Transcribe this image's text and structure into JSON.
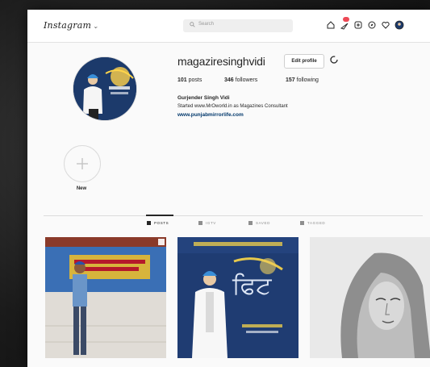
{
  "topbar": {
    "logo": "Instagram",
    "search_placeholder": "Search"
  },
  "profile": {
    "username": "magaziresinghvidi",
    "edit_button": "Edit profile",
    "stats": {
      "posts_count": "101",
      "posts_label": "posts",
      "followers_count": "346",
      "followers_label": "followers",
      "following_count": "157",
      "following_label": "following"
    },
    "bio": {
      "name": "Gurjender Singh Vidi",
      "line": "Started www.MrOworld.in as Magazines Consultant",
      "link": "www.punjabmirrorlife.com"
    }
  },
  "highlights": {
    "new_label": "New"
  },
  "tabs": [
    {
      "label": "POSTS"
    },
    {
      "label": "IGTV"
    },
    {
      "label": "SAVED"
    },
    {
      "label": "TAGGED"
    }
  ],
  "posts": [
    {
      "caption": "Event on stage"
    },
    {
      "caption": "Portrait poster"
    },
    {
      "caption": "Sketch portrait"
    }
  ],
  "colors": {
    "accent_link": "#00376b",
    "notification": "#ed4956",
    "poster_blue": "#1c3a6b"
  }
}
